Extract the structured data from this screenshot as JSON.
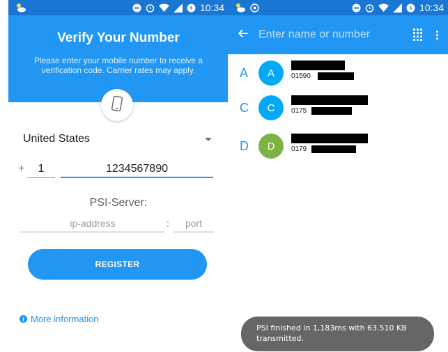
{
  "left_screen": {
    "status_bar": {
      "time": "10:34"
    },
    "header": {
      "title": "Verify Your Number",
      "subtitle": "Please enter your mobile number to receive a verification code. Carrier rates may apply."
    },
    "country_select": {
      "value": "United States"
    },
    "phone": {
      "plus": "+",
      "country_code": "1",
      "number": "1234567890"
    },
    "psi_server": {
      "label": "PSI-Server:",
      "ip_placeholder": "ip-address",
      "separator": ":",
      "port_placeholder": "port"
    },
    "register_label": "REGISTER",
    "more_info_label": "More information"
  },
  "right_screen": {
    "status_bar": {
      "time": "10:34"
    },
    "search": {
      "placeholder": "Enter name or number"
    },
    "contacts": [
      {
        "letter": "A",
        "initial": "A",
        "avatar_color": "#03a9f4",
        "number_prefix": "01590"
      },
      {
        "letter": "C",
        "initial": "C",
        "avatar_color": "#03a9f4",
        "number_prefix": "0175"
      },
      {
        "letter": "D",
        "initial": "D",
        "avatar_color": "#7cb342",
        "number_prefix": "0179"
      }
    ],
    "toast": "PSI finished in 1,183ms with 63.510 KB transmitted."
  },
  "colors": {
    "status_bar": "#1976d2",
    "primary": "#2196f3",
    "toast_bg": "#666666"
  },
  "icons": {
    "status": [
      "weather-icon",
      "minus-circle-icon",
      "alarm-icon",
      "wifi-icon",
      "signal-icon",
      "battery-icon"
    ],
    "header": [
      "phone-icon"
    ],
    "search_bar": [
      "back-arrow-icon",
      "dialpad-icon",
      "more-vert-icon"
    ]
  }
}
